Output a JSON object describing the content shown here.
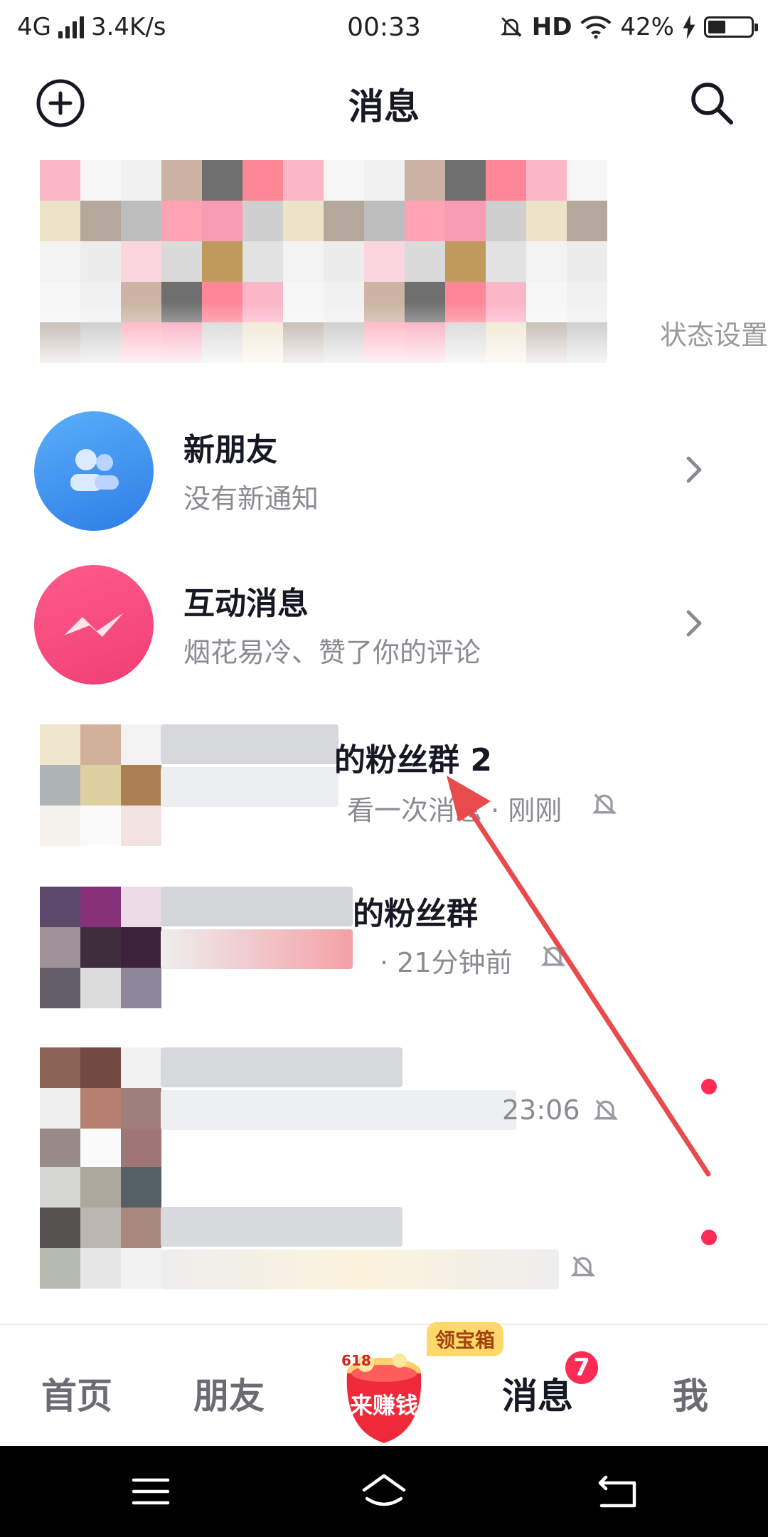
{
  "status_bar": {
    "network": "4G",
    "speed": "3.4K/s",
    "time": "00:33",
    "hd": "HD",
    "battery": "42%",
    "battery_level": 0.42
  },
  "header": {
    "title": "消息"
  },
  "top_panel": {
    "status_setting": "状态设置"
  },
  "rows": [
    {
      "name": "新朋友",
      "sub": "没有新通知"
    },
    {
      "name": "互动消息",
      "sub": "烟花易冷、赞了你的评论"
    },
    {
      "name": "的粉丝群 2",
      "sub": "看一次消息 · 刚刚"
    },
    {
      "name": "的粉丝群",
      "sub": "· 21分钟前"
    },
    {
      "name": "",
      "sub": "23:06"
    },
    {
      "name": "",
      "sub": ""
    }
  ],
  "tabs": {
    "home": "首页",
    "friends": "朋友",
    "earn": "来赚钱",
    "earn_618": "618",
    "chest": "领宝箱",
    "messages": "消息",
    "messages_badge": "7",
    "me": "我"
  },
  "colors": {
    "accent": "#fe2c55",
    "new_friends_avatar": "#3d8cf0",
    "interaction_avatar": "#f4407a",
    "annotation_arrow": "#e74b4b"
  }
}
